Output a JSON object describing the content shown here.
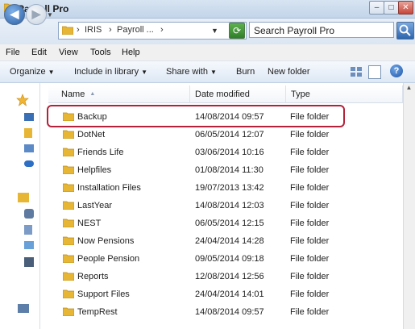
{
  "window": {
    "title": "Payroll Pro",
    "controls": {
      "minimize": "–",
      "maximize": "□",
      "close": "✕"
    }
  },
  "address": {
    "crumbs": [
      "IRIS",
      "Payroll ..."
    ],
    "overflow": "›"
  },
  "search": {
    "placeholder": "Search Payroll Pro"
  },
  "menu": [
    "File",
    "Edit",
    "View",
    "Tools",
    "Help"
  ],
  "commands": {
    "organize": "Organize",
    "include": "Include in library",
    "share": "Share with",
    "burn": "Burn",
    "new_folder": "New folder"
  },
  "columns": {
    "name": "Name",
    "date": "Date modified",
    "type": "Type"
  },
  "files": [
    {
      "name": "Backup",
      "date": "14/08/2014 09:57",
      "type": "File folder"
    },
    {
      "name": "DotNet",
      "date": "06/05/2014 12:07",
      "type": "File folder"
    },
    {
      "name": "Friends Life",
      "date": "03/06/2014 10:16",
      "type": "File folder"
    },
    {
      "name": "Helpfiles",
      "date": "01/08/2014 11:30",
      "type": "File folder"
    },
    {
      "name": "Installation Files",
      "date": "19/07/2013 13:42",
      "type": "File folder"
    },
    {
      "name": "LastYear",
      "date": "14/08/2014 12:03",
      "type": "File folder"
    },
    {
      "name": "NEST",
      "date": "06/05/2014 12:15",
      "type": "File folder"
    },
    {
      "name": "Now Pensions",
      "date": "24/04/2014 14:28",
      "type": "File folder"
    },
    {
      "name": "People Pension",
      "date": "09/05/2014 09:18",
      "type": "File folder"
    },
    {
      "name": "Reports",
      "date": "12/08/2014 12:56",
      "type": "File folder"
    },
    {
      "name": "Support Files",
      "date": "24/04/2014 14:01",
      "type": "File folder"
    },
    {
      "name": "TempRest",
      "date": "14/08/2014 09:57",
      "type": "File folder"
    }
  ],
  "colors": {
    "highlight": "#b5213a",
    "folder": "#e7b634"
  }
}
